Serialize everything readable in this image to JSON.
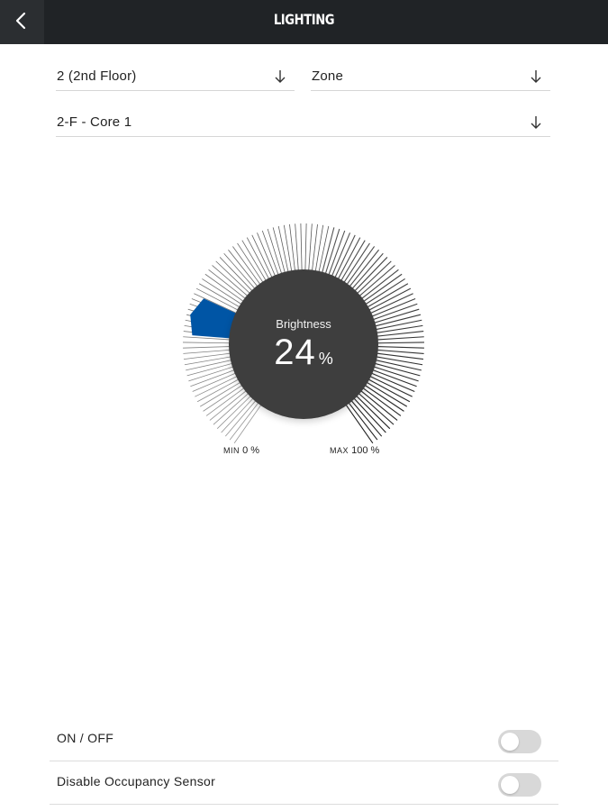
{
  "header": {
    "title": "LIGHTING",
    "back_icon": "chevron-left-icon"
  },
  "selectors": {
    "floor": {
      "value": "2 (2nd Floor)",
      "icon": "arrow-down-icon"
    },
    "zone": {
      "value": "Zone",
      "icon": "arrow-down-icon"
    },
    "room": {
      "value": "2-F - Core 1",
      "icon": "arrow-down-icon"
    }
  },
  "brightness": {
    "label": "Brightness",
    "value": "24",
    "unit": "%",
    "level_percent": 24,
    "min_prefix": "MIN",
    "min_value": "0 %",
    "max_prefix": "MAX",
    "max_value": "100 %",
    "accent_color": "#0055a5"
  },
  "controls": {
    "on_off": {
      "label": "ON / OFF",
      "state": "off"
    },
    "occupancy": {
      "label": "Disable Occupancy Sensor",
      "state": "off"
    }
  }
}
